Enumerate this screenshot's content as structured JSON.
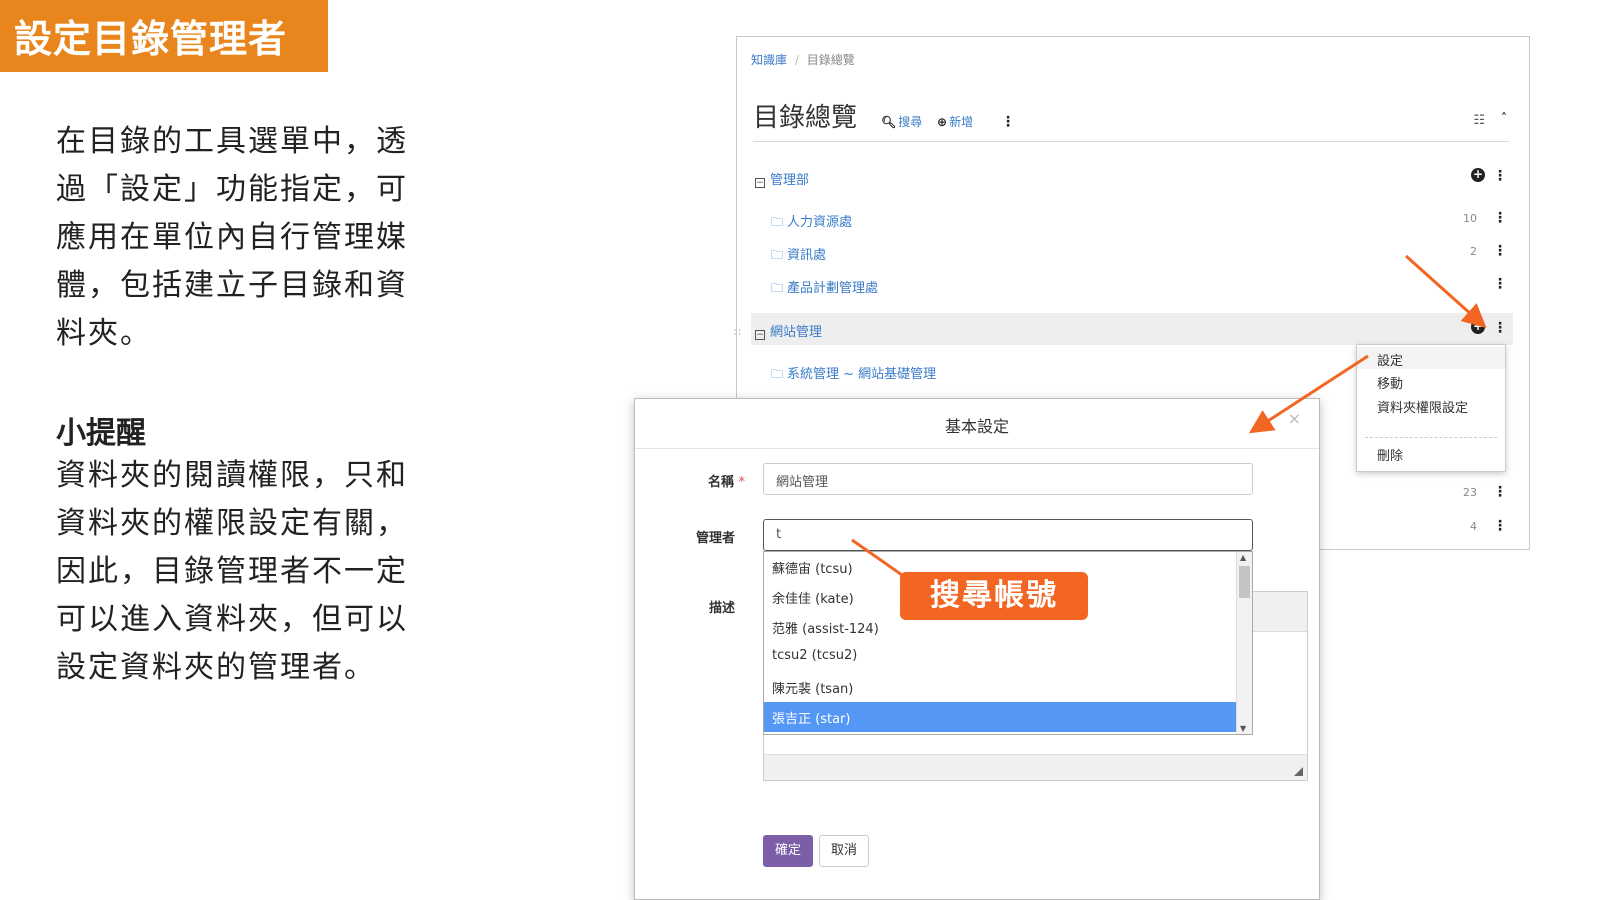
{
  "slide": {
    "title": "設定目錄管理者",
    "intro": "在目錄的工具選單中，透過「設定」功能指定，可應用在單位內自行管理媒體，包括建立子目錄和資料夾。",
    "tip_title": "小提醒",
    "tip_text": "資料夾的閱讀權限，只和資料夾的權限設定有關，因此，目錄管理者不一定可以進入資料夾，但可以設定資料夾的管理者。",
    "callout": "搜尋帳號",
    "accent_color": "#e8861d",
    "callout_color": "#f26522"
  },
  "directory": {
    "breadcrumb": {
      "root": "知識庫",
      "sep": "/",
      "current": "目錄總覽"
    },
    "title": "目錄總覽",
    "search_label": "搜尋",
    "add_label": "新增",
    "search_icon": "search-icon",
    "add_icon": "plus-circle-icon",
    "tree": [
      {
        "label": "管理部",
        "kind": "group",
        "count": ""
      },
      {
        "label": "人力資源處",
        "kind": "shared-folder",
        "count": "10"
      },
      {
        "label": "資訊處",
        "kind": "shared-folder",
        "count": "2"
      },
      {
        "label": "產品計劃管理處",
        "kind": "shared-folder",
        "count": ""
      },
      {
        "label": "網站管理",
        "kind": "group",
        "count": ""
      },
      {
        "label": "系統管理 ~ 網站基礎管理",
        "kind": "folder",
        "count": ""
      }
    ],
    "hidden_counts": [
      "23",
      "4"
    ]
  },
  "context_menu": {
    "items": [
      "設定",
      "移動",
      "資料夾權限設定"
    ],
    "danger_item": "刪除"
  },
  "dialog": {
    "title": "基本設定",
    "close_label": "×",
    "name_label": "名稱",
    "required_mark": "*",
    "name_value": "網站管理",
    "manager_label": "管理者",
    "manager_value": "t",
    "desc_label": "描述",
    "suggestions": [
      "蘇德宙 (tcsu)",
      "余佳佳 (kate)",
      "范雅 (assist-124)",
      "tcsu2 (tcsu2)",
      "陳元裴 (tsan)",
      "張吉正 (star)"
    ],
    "selected_index": 5,
    "ok_label": "確定",
    "cancel_label": "取消",
    "ok_color": "#7b5ea7",
    "highlight_color": "#5497f4"
  }
}
